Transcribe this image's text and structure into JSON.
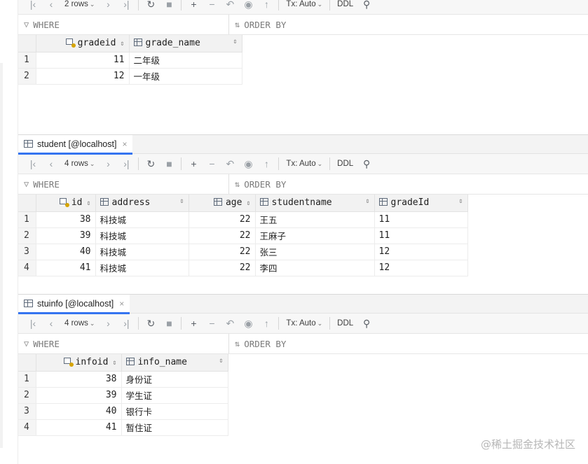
{
  "toolbar_common": {
    "tx_label": "Tx: Auto",
    "ddl_label": "DDL",
    "where_label": "WHERE",
    "order_label": "ORDER BY"
  },
  "panels": [
    {
      "tab_title": "",
      "rows_label": "2 rows",
      "columns": [
        "gradeid",
        "grade_name"
      ],
      "rows": [
        {
          "n": "1",
          "cells": [
            "11",
            "二年级"
          ]
        },
        {
          "n": "2",
          "cells": [
            "12",
            "一年级"
          ]
        }
      ]
    },
    {
      "tab_title": "student [@localhost]",
      "rows_label": "4 rows",
      "columns": [
        "id",
        "address",
        "age",
        "studentname",
        "gradeId"
      ],
      "rows": [
        {
          "n": "1",
          "cells": [
            "38",
            "科技城",
            "22",
            "王五",
            "11"
          ]
        },
        {
          "n": "2",
          "cells": [
            "39",
            "科技城",
            "22",
            "王麻子",
            "11"
          ]
        },
        {
          "n": "3",
          "cells": [
            "40",
            "科技城",
            "22",
            "张三",
            "12"
          ]
        },
        {
          "n": "4",
          "cells": [
            "41",
            "科技城",
            "22",
            "李四",
            "12"
          ]
        }
      ]
    },
    {
      "tab_title": "stuinfo [@localhost]",
      "rows_label": "4 rows",
      "columns": [
        "infoid",
        "info_name"
      ],
      "rows": [
        {
          "n": "1",
          "cells": [
            "38",
            "身份证"
          ]
        },
        {
          "n": "2",
          "cells": [
            "39",
            "学生证"
          ]
        },
        {
          "n": "3",
          "cells": [
            "40",
            "银行卡"
          ]
        },
        {
          "n": "4",
          "cells": [
            "41",
            "暂住证"
          ]
        }
      ]
    }
  ],
  "watermark": "@稀土掘金技术社区",
  "colors": {
    "accent": "#3574f0",
    "key": "#d6a400",
    "header_bg": "#f2f2f2"
  }
}
